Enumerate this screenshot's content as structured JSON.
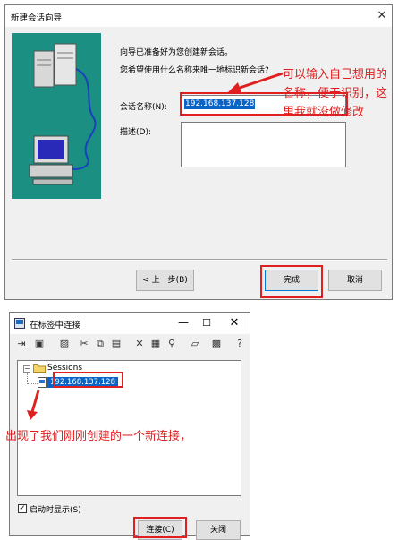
{
  "wizard": {
    "title": "新建会话向导",
    "prompt_line1": "向导已准备好为您创建新会话。",
    "prompt_line2": "您希望使用什么名称来唯一地标识新会话?",
    "name_label": "会话名称(N):",
    "name_value": "192.168.137.128",
    "desc_label": "描述(D):",
    "desc_value": "",
    "back_label": "< 上一步(B)",
    "finish_label": "完成",
    "cancel_label": "取消",
    "annotation": "可以输入自己想用的名称，便于识别，这里我就没做修改"
  },
  "connect": {
    "title": "在标签中连接",
    "toolbar_icons": [
      "connect-icon",
      "quick-connect-icon",
      "image-icon",
      "cut-icon",
      "copy-icon",
      "paste-icon",
      "delete-icon",
      "properties-icon",
      "find-icon",
      "new-folder-icon",
      "session-icon",
      "help-icon"
    ],
    "tree_root": "Sessions",
    "session_name": "192.168.137.128",
    "show_on_startup_label": "启动时显示(S)",
    "show_on_startup_checked": true,
    "connect_label": "连接(C)",
    "close_label": "关闭",
    "annotation": "出现了我们刚刚创建的一个新连接，"
  },
  "colors": {
    "highlight_red": "#e02020",
    "selection_blue": "#0a64c8",
    "art_teal": "#1b8f82"
  }
}
